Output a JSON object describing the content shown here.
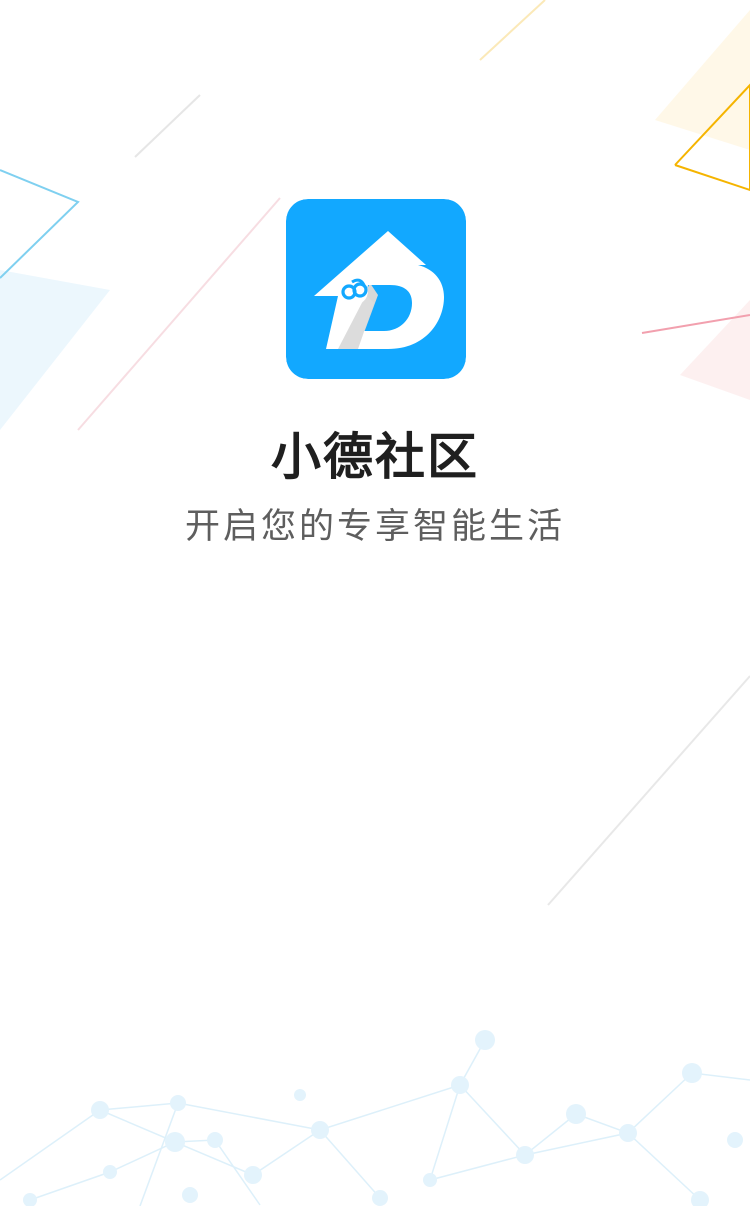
{
  "splash": {
    "app_icon": "xiaode-community-logo-icon",
    "app_name": "小德社区",
    "slogan": "开启您的专享智能生活"
  },
  "colors": {
    "brand_blue": "#12A8FF",
    "background": "#FFFFFF",
    "title_text": "#1F1F1F",
    "slogan_text": "#5E5E5E",
    "accent_yellow": "#F5B400",
    "accent_pink": "#F2A0AE",
    "accent_cyan": "#7FD0F0"
  }
}
